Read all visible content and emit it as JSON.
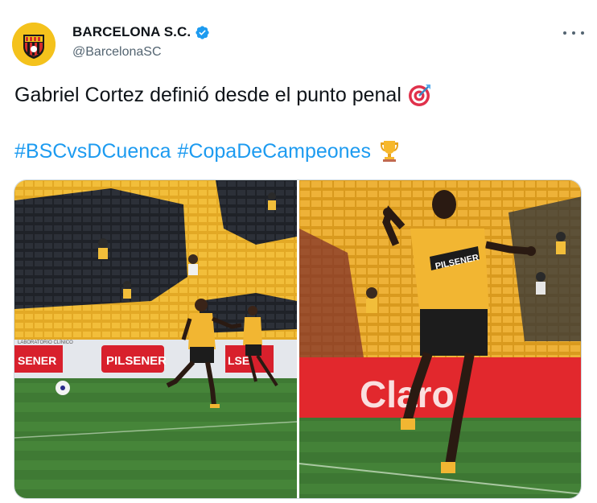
{
  "tweet": {
    "author": {
      "name": "BARCELONA S.C.",
      "handle": "@BarcelonaSC",
      "avatar_icon": "barcelona-sc-crest-icon",
      "verified": true
    },
    "text_line1": "Gabriel Cortez definió desde el punto penal",
    "text_line1_emoji": "direct-hit-target-emoji",
    "hashtags": [
      "#BSCvsDCuenca",
      "#CopaDeCampeones"
    ],
    "hashtags_emoji": "trophy-emoji",
    "media": [
      {
        "description": "Player in yellow kit striking the ball with stadium stands behind",
        "ad_boards": [
          "PILSENER",
          "LABORATORIO CLÍNICO"
        ]
      },
      {
        "description": "Player celebrating with fists raised in front of Claro advertising board",
        "ad_boards": [
          "PILSENER",
          "Claro"
        ]
      }
    ]
  },
  "colors": {
    "link": "#1d9bf0",
    "secondary_text": "#536471",
    "primary_text": "#0f1419",
    "verified_badge": "#1d9bf0",
    "kit_yellow": "#f2b632"
  }
}
